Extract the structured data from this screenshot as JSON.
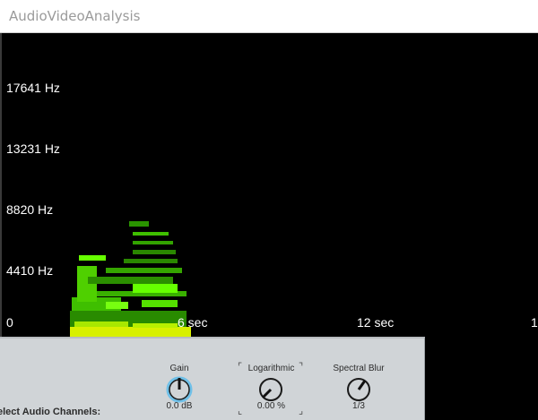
{
  "window": {
    "title": "AudioVideoAnalysis"
  },
  "spectrogram": {
    "freq_labels": [
      "17641 Hz",
      "13231 Hz",
      "8820 Hz",
      "4410 Hz"
    ],
    "time_labels": [
      "0",
      "6 sec",
      "12 sec",
      "1"
    ],
    "colors": {
      "low": "#2fa000",
      "mid": "#66ff00",
      "high": "#e6ff00"
    }
  },
  "controls": {
    "gain": {
      "label": "Gain",
      "value": "0.0 dB"
    },
    "logarithmic": {
      "label": "Logarithmic",
      "value": "0.00 %"
    },
    "spectral_blur": {
      "label": "Spectral Blur",
      "value": "1/3"
    },
    "channels_label": "elect Audio Channels:"
  }
}
